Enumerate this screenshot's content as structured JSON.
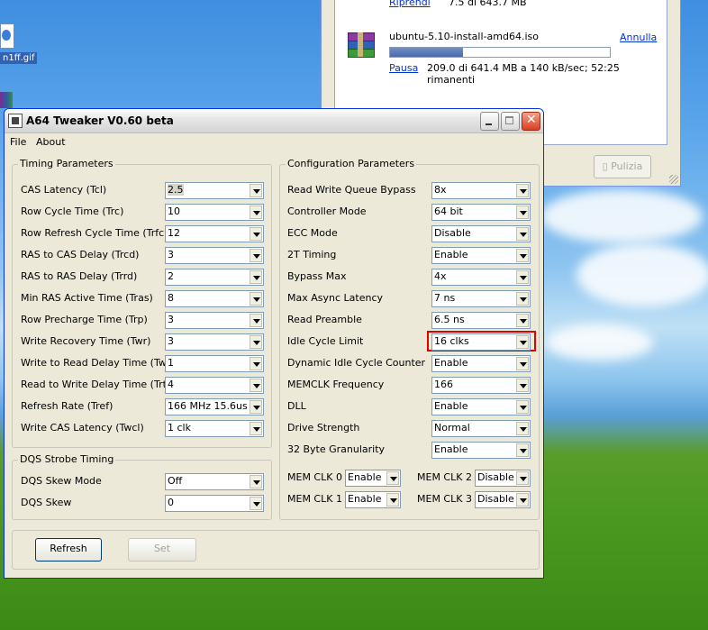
{
  "desktop": {
    "gif_label": "n1ff.gif"
  },
  "download": {
    "top_link": "Riprendi",
    "top_progress": "7.5 di 643.7 MB",
    "file_name": "ubuntu-5.10-install-amd64.iso",
    "cancel_link": "Annulla",
    "pause_link": "Pausa",
    "status": "209.0 di 641.4 MB a 140 kB/sec; 52:25 rimanenti",
    "progress_fraction": 0.33,
    "cleanup_button": "Pulizia"
  },
  "window": {
    "title": "A64 Tweaker V0.60 beta"
  },
  "menu": {
    "file": "File",
    "about": "About"
  },
  "timing": {
    "title": "Timing Parameters",
    "rows": [
      {
        "label": "CAS Latency (Tcl)",
        "value": "2.5"
      },
      {
        "label": "Row Cycle Time (Trc)",
        "value": "10"
      },
      {
        "label": "Row Refresh Cycle Time (Trfc)",
        "value": "12"
      },
      {
        "label": "RAS to CAS Delay (Trcd)",
        "value": "3"
      },
      {
        "label": "RAS to RAS Delay (Trrd)",
        "value": "2"
      },
      {
        "label": "Min RAS Active Time (Tras)",
        "value": "8"
      },
      {
        "label": "Row Precharge Time (Trp)",
        "value": "3"
      },
      {
        "label": "Write Recovery Time (Twr)",
        "value": "3"
      },
      {
        "label": "Write to Read Delay Time (Twtr)",
        "value": "1"
      },
      {
        "label": "Read to Write Delay Time (Trtw)",
        "value": "4"
      },
      {
        "label": "Refresh Rate (Tref)",
        "value": "166 MHz 15.6us"
      },
      {
        "label": "Write CAS Latency (Twcl)",
        "value": "1 clk"
      }
    ]
  },
  "dqs": {
    "title": "DQS Strobe Timing",
    "rows": [
      {
        "label": "DQS Skew Mode",
        "value": "Off"
      },
      {
        "label": "DQS Skew",
        "value": "0"
      }
    ]
  },
  "config": {
    "title": "Configuration Parameters",
    "rows": [
      {
        "label": "Read Write Queue Bypass",
        "value": "8x"
      },
      {
        "label": "Controller Mode",
        "value": "64 bit"
      },
      {
        "label": "ECC Mode",
        "value": "Disable"
      },
      {
        "label": "2T Timing",
        "value": "Enable"
      },
      {
        "label": "Bypass Max",
        "value": "4x"
      },
      {
        "label": "Max Async Latency",
        "value": "7 ns"
      },
      {
        "label": "Read Preamble",
        "value": "6.5 ns"
      },
      {
        "label": "Idle Cycle Limit",
        "value": "16 clks"
      },
      {
        "label": "Dynamic Idle Cycle Counter",
        "value": "Enable"
      },
      {
        "label": "MEMCLK Frequency",
        "value": "166"
      },
      {
        "label": "DLL",
        "value": "Enable"
      },
      {
        "label": "Drive Strength",
        "value": "Normal"
      },
      {
        "label": "32 Byte Granularity",
        "value": "Enable"
      }
    ],
    "memclk": [
      {
        "label": "MEM CLK 0",
        "value": "Enable"
      },
      {
        "label": "MEM CLK 2",
        "value": "Disable"
      },
      {
        "label": "MEM CLK 1",
        "value": "Enable"
      },
      {
        "label": "MEM CLK 3",
        "value": "Disable"
      }
    ]
  },
  "buttons": {
    "refresh": "Refresh",
    "set": "Set"
  },
  "colors": {
    "highlight": "#e00000",
    "title_active": "#0831d9"
  }
}
